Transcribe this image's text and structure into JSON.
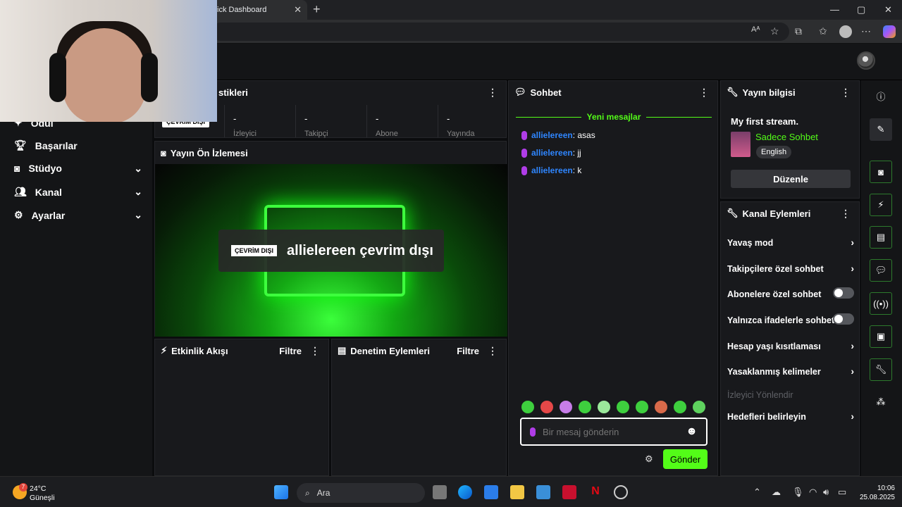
{
  "browser": {
    "tab_title": "ick Dashboard",
    "tab_close": "✕",
    "new_tab": "+",
    "minimize": "—",
    "maximize": "▢",
    "close": "✕"
  },
  "sidebar": {
    "items": [
      {
        "label": "Ödül",
        "icon": "gift-icon"
      },
      {
        "label": "Başarılar",
        "icon": "trophy-icon"
      },
      {
        "label": "Stüdyo",
        "icon": "camera-icon",
        "expandable": true
      },
      {
        "label": "Kanal",
        "icon": "users-icon",
        "expandable": true
      },
      {
        "label": "Ayarlar",
        "icon": "gear-icon",
        "expandable": true
      }
    ]
  },
  "stats": {
    "title": "stikleri",
    "offline_badge": "ÇEVRİM DIŞI",
    "items": [
      {
        "value": "-",
        "label": "İzleyici"
      },
      {
        "value": "-",
        "label": "Takipçi"
      },
      {
        "value": "-",
        "label": "Abone"
      },
      {
        "value": "-",
        "label": "Yayında"
      }
    ]
  },
  "preview": {
    "title": "Yayın Ön İzlemesi",
    "badge": "ÇEVRİM DIŞI",
    "status_text": "allielereen çevrim dışı"
  },
  "activity": {
    "title": "Etkinlik Akışı",
    "filter": "Filtre"
  },
  "moderation": {
    "title": "Denetim Eylemleri",
    "filter": "Filtre"
  },
  "chat": {
    "title": "Sohbet",
    "new_messages": "Yeni mesajlar",
    "messages": [
      {
        "user": "allielereen",
        "text": ": asas"
      },
      {
        "user": "allielereen",
        "text": ": jj"
      },
      {
        "user": "allielereen",
        "text": ": k"
      }
    ],
    "placeholder": "Bir mesaj gönderin",
    "send": "Gönder"
  },
  "stream_info": {
    "title": "Yayın bilgisi",
    "stream_title": "My first stream.",
    "category": "Sadece Sohbet",
    "language": "English",
    "edit": "Düzenle"
  },
  "channel_actions": {
    "title": "Kanal Eylemleri",
    "items": [
      {
        "label": "Yavaş mod",
        "control": "arrow"
      },
      {
        "label": "Takipçilere özel sohbet",
        "control": "arrow"
      },
      {
        "label": "Abonelere özel sohbet",
        "control": "toggle",
        "on": false
      },
      {
        "label": "Yalnızca ifadelerle sohbet",
        "control": "toggle",
        "on": false
      },
      {
        "label": "Hesap yaşı kısıtlaması",
        "control": "arrow"
      },
      {
        "label": "Yasaklanmış kelimeler",
        "control": "arrow"
      },
      {
        "label": "İzleyici Yönlendir",
        "control": "none",
        "disabled": true
      },
      {
        "label": "Hedefleri belirleyin",
        "control": "arrow"
      }
    ]
  },
  "taskbar": {
    "weather_badge": "7",
    "temp": "24°C",
    "condition": "Güneşli",
    "search": "Ara",
    "time": "10:06",
    "date": "25.08.2025"
  },
  "colors": {
    "accent": "#53fc18",
    "username": "#2f86ff",
    "panel": "#18191c"
  }
}
